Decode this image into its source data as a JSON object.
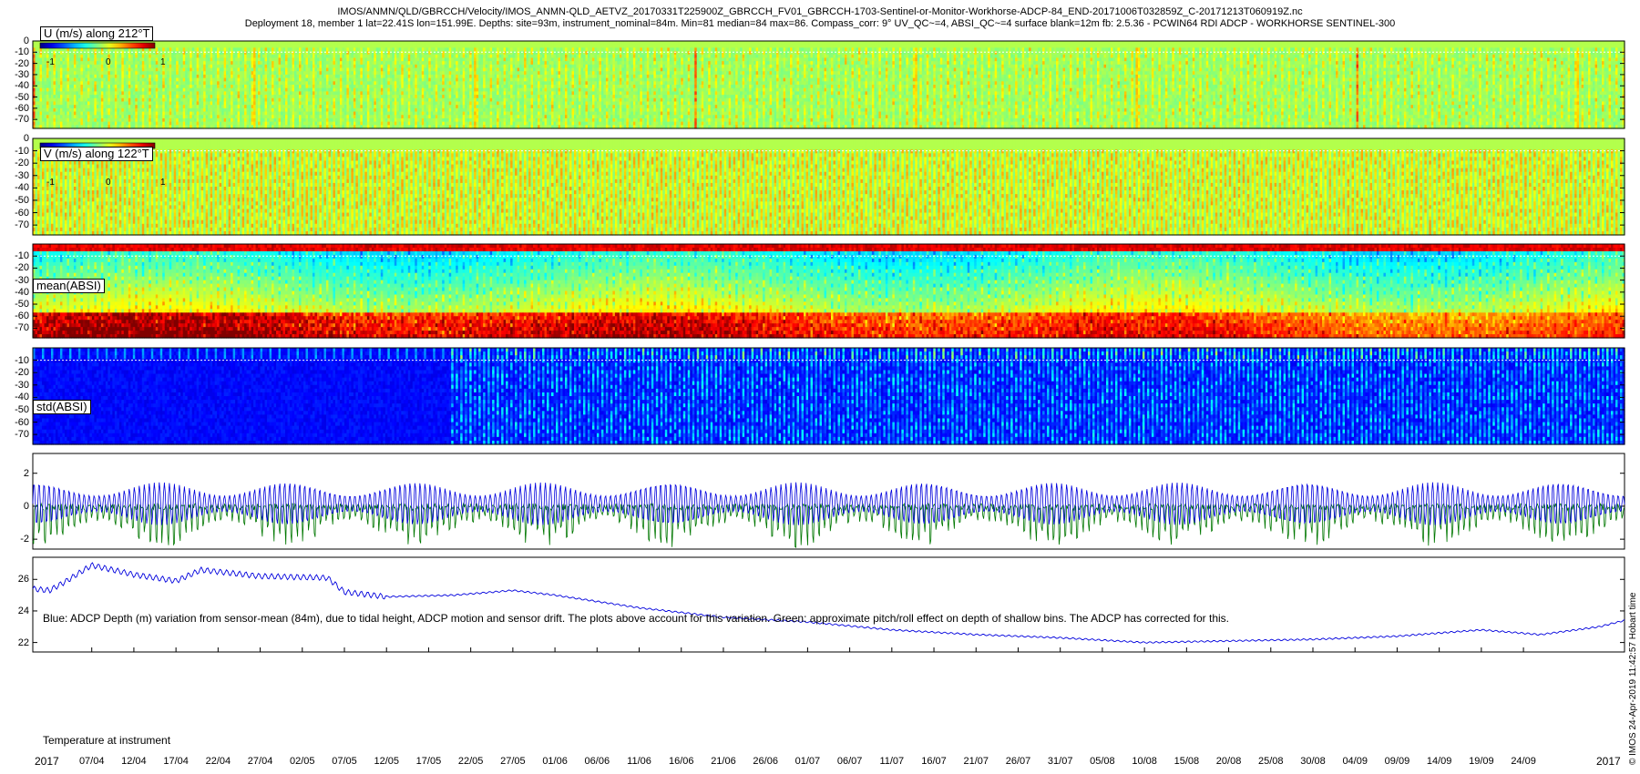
{
  "header": {
    "line1": "IMOS/ANMN/QLD/GBRCCH/Velocity/IMOS_ANMN-QLD_AETVZ_20170331T225900Z_GBRCCH_FV01_GBRCCH-1703-Sentinel-or-Monitor-Workhorse-ADCP-84_END-20171006T032859Z_C-20171213T060919Z.nc",
    "line2": "Deployment 18, member 1 lat=22.41S lon=151.99E. Depths: site=93m, instrument_nominal=84m. Min=81 median=84 max=86. Compass_corr: 9° UV_QC~=4, ABSI_QC~=4 surface blank=12m fb: 2.5.36 - PCWIN64 RDI ADCP - WORKHORSE SENTINEL-300"
  },
  "side_note": "© IMOS 24-Apr-2019 11:42:57 Hobart time",
  "colors": {
    "depth_series": "#0000dd",
    "pitch_roll_series": "#007700",
    "temperature_series": "#0000dd"
  },
  "chart_data": [
    {
      "type": "heatmap",
      "title": "U (m/s) along 212°T",
      "colormap": "jet",
      "clim": [
        -1,
        1
      ],
      "colorbar_ticks": [
        "-1",
        "0",
        "1"
      ],
      "yticks": [
        "0",
        "-10",
        "-20",
        "-30",
        "-40",
        "-50",
        "-60",
        "-70"
      ],
      "ylim": [
        -78,
        0
      ],
      "dominant_value": 0.1
    },
    {
      "type": "heatmap",
      "title": "V (m/s) along 122°T",
      "colormap": "jet",
      "clim": [
        -1,
        1
      ],
      "colorbar_ticks": [
        "-1",
        "0",
        "1"
      ],
      "yticks": [
        "0",
        "-10",
        "-20",
        "-30",
        "-40",
        "-50",
        "-60",
        "-70"
      ],
      "ylim": [
        -78,
        0
      ],
      "dominant_value": 0.15
    },
    {
      "type": "heatmap",
      "title": "mean(ABSI)",
      "colormap": "jet",
      "yticks": [
        "-10",
        "-20",
        "-30",
        "-40",
        "-50",
        "-60",
        "-70"
      ],
      "ylim": [
        -78,
        0
      ]
    },
    {
      "type": "heatmap",
      "title": "std(ABSI)",
      "colormap": "jet",
      "yticks": [
        "-10",
        "-20",
        "-30",
        "-40",
        "-50",
        "-60",
        "-70"
      ],
      "ylim": [
        -78,
        0
      ]
    },
    {
      "type": "line",
      "annotation": "Blue: ADCP Depth (m) variation from sensor-mean (84m), due to tidal height, ADCP motion and sensor drift. The plots above account for this variation. Green: approximate pitch/roll effect on depth of shallow bins. The ADCP has corrected for this.",
      "yticks": [
        "2",
        "0",
        "-2"
      ],
      "ylim": [
        -2.6,
        3.2
      ],
      "series": [
        {
          "tidal_amplitude_range": [
            0.5,
            1.3
          ]
        },
        {
          "min_value": -2.5
        }
      ]
    },
    {
      "type": "line",
      "annotation": "Temperature at instrument",
      "yticks": [
        "26",
        "24",
        "22"
      ],
      "ylim": [
        21.4,
        27.4
      ],
      "series": [
        {
          "x": [
            "2017-03-31",
            "2017-04-02",
            "2017-04-04",
            "2017-04-07",
            "2017-04-12",
            "2017-04-17",
            "2017-04-20",
            "2017-04-27",
            "2017-05-05",
            "2017-05-07",
            "2017-05-12",
            "2017-05-20",
            "2017-05-27",
            "2017-06-01",
            "2017-06-11",
            "2017-06-21",
            "2017-07-01",
            "2017-07-11",
            "2017-07-21",
            "2017-07-31",
            "2017-08-10",
            "2017-08-20",
            "2017-08-30",
            "2017-09-09",
            "2017-09-19",
            "2017-09-26",
            "2017-10-03",
            "2017-10-06"
          ],
          "y": [
            25.4,
            25.3,
            25.9,
            26.9,
            26.3,
            25.9,
            26.6,
            26.2,
            26.1,
            25.2,
            24.9,
            25.0,
            25.3,
            25.0,
            24.2,
            23.6,
            23.3,
            22.8,
            22.5,
            22.3,
            22.0,
            22.1,
            22.2,
            22.4,
            22.8,
            22.5,
            23.0,
            23.4
          ]
        }
      ]
    },
    {
      "type": "axis",
      "xtick_labels": [
        "07/04",
        "12/04",
        "17/04",
        "22/04",
        "27/04",
        "02/05",
        "07/05",
        "12/05",
        "17/05",
        "22/05",
        "27/05",
        "01/06",
        "06/06",
        "11/06",
        "16/06",
        "21/06",
        "26/06",
        "01/07",
        "06/07",
        "11/07",
        "16/07",
        "21/07",
        "26/07",
        "31/07",
        "05/08",
        "10/08",
        "15/08",
        "20/08",
        "25/08",
        "30/08",
        "04/09",
        "09/09",
        "14/09",
        "19/09",
        "24/09"
      ],
      "year_left": "2017",
      "year_right": "2017",
      "start_date": "2017-03-31",
      "end_date": "2017-10-06"
    }
  ]
}
